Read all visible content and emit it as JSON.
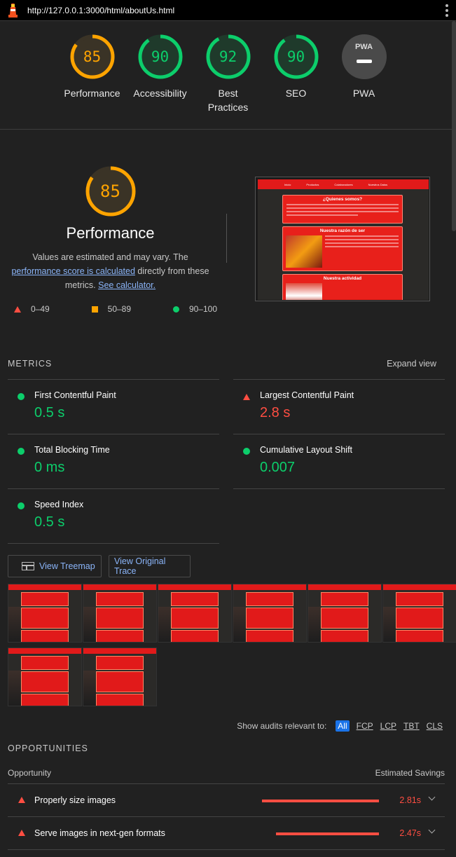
{
  "url": "http://127.0.0.1:3000/html/aboutUs.html",
  "colors": {
    "pass": "#0cce6b",
    "average": "#ffa400",
    "fail": "#ff4e42",
    "link": "#8ab4f8",
    "gray": "#9e9e9e"
  },
  "gauges": [
    {
      "score": "85",
      "label": "Performance",
      "status": "average",
      "fraction": 0.85
    },
    {
      "score": "90",
      "label": "Accessibility",
      "status": "pass",
      "fraction": 0.9
    },
    {
      "score": "92",
      "label": "Best Practices",
      "status": "pass",
      "fraction": 0.92
    },
    {
      "score": "90",
      "label": "SEO",
      "status": "pass",
      "fraction": 0.9
    },
    {
      "score": "",
      "label": "PWA",
      "status": "pwa",
      "badge": "PWA"
    }
  ],
  "performance": {
    "score": "85",
    "fraction": 0.85,
    "title": "Performance",
    "desc_1": "Values are estimated and may vary. The ",
    "link_1": "performance score is calculated",
    "desc_2": " directly from these metrics. ",
    "link_2": "See calculator."
  },
  "legend": [
    {
      "range": "0–49",
      "shape": "triangle"
    },
    {
      "range": "50–89",
      "shape": "square"
    },
    {
      "range": "90–100",
      "shape": "circle"
    }
  ],
  "screenshot": {
    "nav": [
      "Inicio",
      "Productos",
      "Colaboradores",
      "Nuestros Datos"
    ],
    "cards": [
      "¿Quienes somos?",
      "Nuestra razón de ser",
      "Nuestra actividad"
    ]
  },
  "metrics_header": {
    "title": "METRICS",
    "expand": "Expand view"
  },
  "metrics": [
    {
      "name": "First Contentful Paint",
      "value": "0.5 s",
      "status": "pass"
    },
    {
      "name": "Largest Contentful Paint",
      "value": "2.8 s",
      "status": "fail"
    },
    {
      "name": "Total Blocking Time",
      "value": "0 ms",
      "status": "pass"
    },
    {
      "name": "Cumulative Layout Shift",
      "value": "0.007",
      "status": "pass"
    },
    {
      "name": "Speed Index",
      "value": "0.5 s",
      "status": "pass"
    }
  ],
  "buttons": {
    "treemap": "View Treemap",
    "trace": "View Original Trace"
  },
  "filmstrip_count": 8,
  "filter": {
    "label": "Show audits relevant to:",
    "chips": [
      "All",
      "FCP",
      "LCP",
      "TBT",
      "CLS"
    ],
    "active": "All"
  },
  "opportunities": {
    "title": "OPPORTUNITIES",
    "col_left": "Opportunity",
    "col_right": "Estimated Savings",
    "items": [
      {
        "title": "Properly size images",
        "savings": "2.81s",
        "fraction": 1.0
      },
      {
        "title": "Serve images in next-gen formats",
        "savings": "2.47s",
        "fraction": 0.88
      }
    ]
  }
}
